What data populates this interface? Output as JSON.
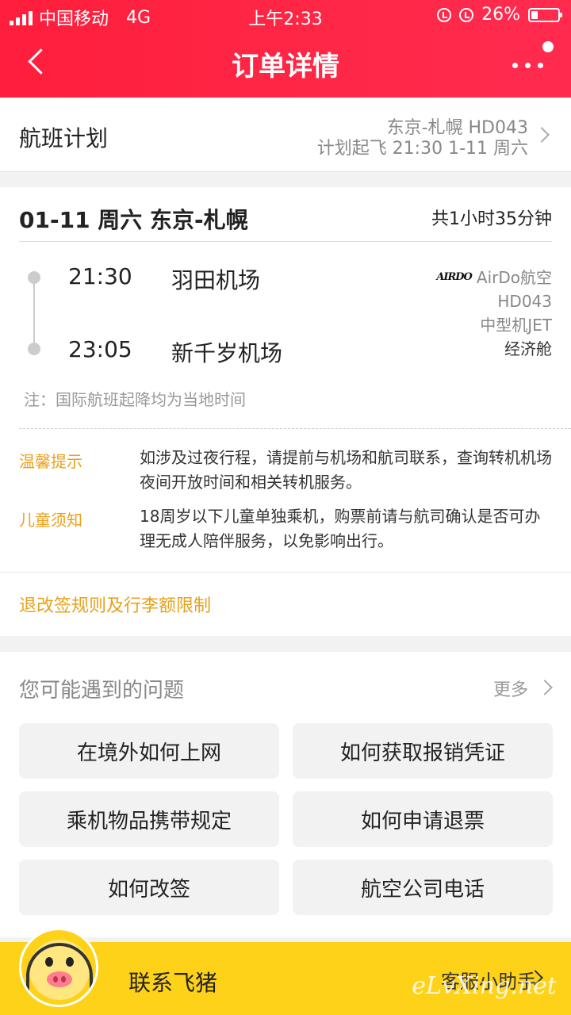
{
  "status_bar": {
    "carrier": "中国移动",
    "network": "4G",
    "time": "上午2:33",
    "battery": "26%"
  },
  "header": {
    "title": "订单详情"
  },
  "flight_plan": {
    "label": "航班计划",
    "route_flight": "东京-札幌 HD043",
    "scheduled": "计划起飞 21:30 1-11 周六"
  },
  "flight": {
    "date_route": "01-11 周六 东京-札幌",
    "duration": "共1小时35分钟",
    "departure_time": "21:30",
    "departure_airport": "羽田机场",
    "arrival_time": "23:05",
    "arrival_airport": "新千岁机场",
    "airline_logo": "AIRDO",
    "airline": "AirDo航空",
    "flight_no": "HD043",
    "aircraft": "中型机JET",
    "cabin": "经济舱",
    "note": "注：国际航班起降均为当地时间"
  },
  "tips": [
    {
      "label": "温馨提示",
      "text": "如涉及过夜行程，请提前与机场和航司联系，查询转机机场夜间开放时间和相关转机服务。"
    },
    {
      "label": "儿童须知",
      "text": "18周岁以下儿童单独乘机，购票前请与航司确认是否可办理无成人陪伴服务，以免影响出行。"
    }
  ],
  "rules_link": "退改签规则及行李额限制",
  "faq": {
    "title": "您可能遇到的问题",
    "more": "更多",
    "items": [
      "在境外如何上网",
      "如何获取报销凭证",
      "乘机物品携带规定",
      "如何申请退票",
      "如何改签",
      "航空公司电话"
    ]
  },
  "bottom_bar": {
    "contact": "联系飞猪",
    "assistant": "客服小助手",
    "watermark": "eLvXing.net"
  },
  "colors": {
    "header_red": "#ff2645",
    "accent_orange": "#e8a11c",
    "bottom_yellow": "#ffd21a"
  }
}
